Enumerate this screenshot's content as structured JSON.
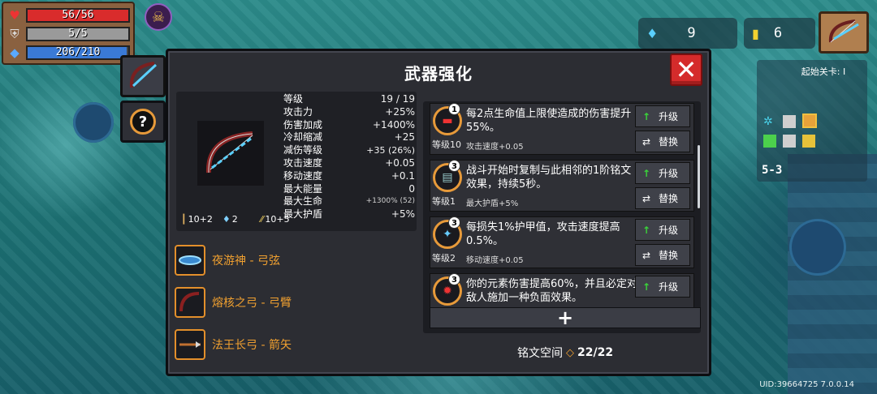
{
  "hud": {
    "hp": {
      "label": "56/56",
      "fraction": 1.0,
      "color": "#d92c2c"
    },
    "shield": {
      "label": "5/5",
      "fraction": 1.0,
      "color": "#9a9a9a"
    },
    "energy": {
      "label": "206/210",
      "fraction": 0.98,
      "color": "#3a7ad6"
    },
    "gems": "9",
    "coins": "6"
  },
  "minimap": {
    "title": "起始关卡: I",
    "level": "5-3"
  },
  "uid": "UID:39664725 7.0.0.14",
  "panel": {
    "title": "武器强化",
    "close": "✕"
  },
  "weapon": {
    "stats": [
      {
        "label": "等级",
        "value": "19 / 19"
      },
      {
        "label": "攻击力",
        "value": "+25%"
      },
      {
        "label": "伤害加成",
        "value": "+1400%"
      },
      {
        "label": "冷却缩减",
        "value": "+25"
      },
      {
        "label": "减伤等级",
        "value": "+35 (26%)"
      },
      {
        "label": "攻击速度",
        "value": "+0.05"
      },
      {
        "label": "移动速度",
        "value": "+0.1"
      },
      {
        "label": "最大能量",
        "value": "0"
      },
      {
        "label": "最大生命",
        "value": "+1300% (52)"
      },
      {
        "label": "最大护盾",
        "value": "+5%"
      }
    ],
    "meta": {
      "dmg": "10+2",
      "crit": "2",
      "spd": "10+5"
    }
  },
  "parts": [
    {
      "label": "夜游神 - 弓弦",
      "icon": "bowstring-icon"
    },
    {
      "label": "熔核之弓 - 弓臂",
      "icon": "bow-arm-icon"
    },
    {
      "label": "法王长弓 - 箭矢",
      "icon": "arrow-icon"
    }
  ],
  "runes": [
    {
      "badge": "1",
      "grade": "等级10",
      "desc": "每2点生命值上限使造成的伤害提升55%。",
      "sub": "攻击速度+0.05",
      "up": "升级",
      "swap": "替换"
    },
    {
      "badge": "3",
      "grade": "等级1",
      "desc": "战斗开始时复制与此相邻的1阶铭文效果，持续5秒。",
      "sub": "最大护盾+5%",
      "up": "升级",
      "swap": "替换"
    },
    {
      "badge": "3",
      "grade": "等级2",
      "desc": "每损失1%护甲值，攻击速度提高0.5%。",
      "sub": "移动速度+0.05",
      "up": "升级",
      "swap": "替换"
    },
    {
      "badge": "3",
      "grade": "",
      "desc": "你的元素伤害提高60%，并且必定对敌人施加一种负面效果。",
      "sub": "",
      "up": "升级",
      "swap": ""
    }
  ],
  "add": "+",
  "rune_space": {
    "label": "铭文空间",
    "count": "22/22"
  }
}
